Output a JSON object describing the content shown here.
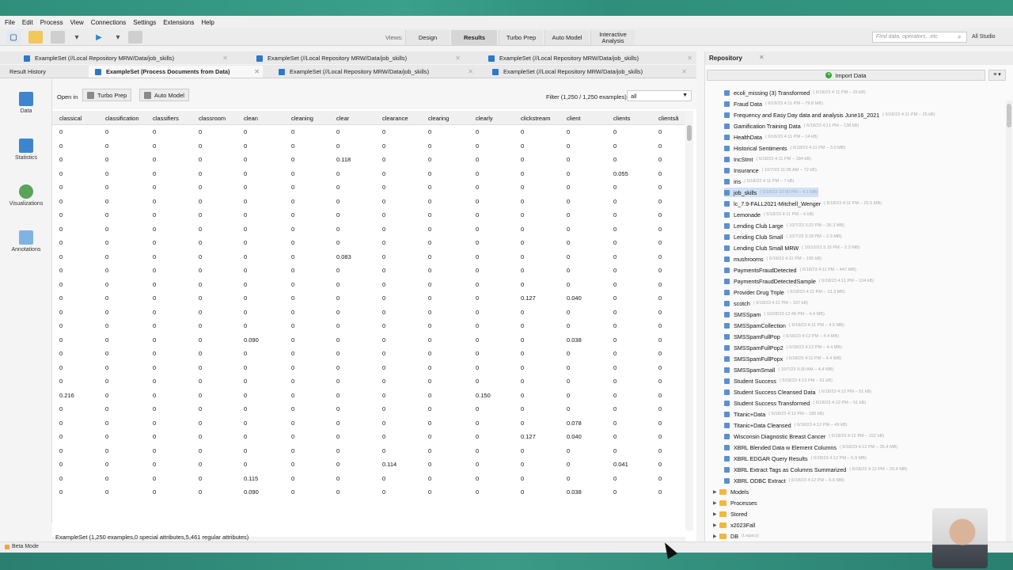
{
  "menu": [
    "File",
    "Edit",
    "Process",
    "View",
    "Connections",
    "Settings",
    "Extensions",
    "Help"
  ],
  "views": {
    "label": "Views:",
    "buttons": [
      "Design",
      "Results",
      "Turbo Prep",
      "Auto Model",
      "Interactive Analysis"
    ],
    "active": "Results"
  },
  "search": {
    "placeholder": "Find data, operators...etc",
    "studio": "All Studio"
  },
  "tabs_row1": [
    "ExampleSet (//Local Repository MRW/Data/job_skills)",
    "ExampleSet (//Local Repository MRW/Data/job_skills)",
    "ExampleSet (//Local Repository MRW/Data/job_skills)"
  ],
  "tabs_row2": [
    "Result History",
    "ExampleSet (Process Documents from Data)",
    "ExampleSet (//Local Repository MRW/Data/job_skills)",
    "ExampleSet (//Local Repository MRW/Data/job_skills)"
  ],
  "left_nav": [
    "Data",
    "Statistics",
    "Visualizations",
    "Annotations"
  ],
  "open_in": {
    "label": "Open in",
    "turbo": "Turbo Prep",
    "auto": "Auto Model"
  },
  "filter": {
    "label": "Filter (1,250 / 1,250 examples):",
    "value": "all"
  },
  "columns": [
    "classical",
    "classification",
    "classifiers",
    "classroom",
    "clean",
    "cleaning",
    "clear",
    "clearance",
    "clearing",
    "clearly",
    "clickstream",
    "client",
    "clients",
    "clientsâ"
  ],
  "rows": [
    [
      "0",
      "0",
      "0",
      "0",
      "0",
      "0",
      "0",
      "0",
      "0",
      "0",
      "0",
      "0",
      "0",
      "0"
    ],
    [
      "0",
      "0",
      "0",
      "0",
      "0",
      "0",
      "0",
      "0",
      "0",
      "0",
      "0",
      "0",
      "0",
      "0"
    ],
    [
      "0",
      "0",
      "0",
      "0",
      "0",
      "0",
      "0.118",
      "0",
      "0",
      "0",
      "0",
      "0",
      "0",
      "0"
    ],
    [
      "0",
      "0",
      "0",
      "0",
      "0",
      "0",
      "0",
      "0",
      "0",
      "0",
      "0",
      "0",
      "0.055",
      "0"
    ],
    [
      "0",
      "0",
      "0",
      "0",
      "0",
      "0",
      "0",
      "0",
      "0",
      "0",
      "0",
      "0",
      "0",
      "0"
    ],
    [
      "0",
      "0",
      "0",
      "0",
      "0",
      "0",
      "0",
      "0",
      "0",
      "0",
      "0",
      "0",
      "0",
      "0"
    ],
    [
      "0",
      "0",
      "0",
      "0",
      "0",
      "0",
      "0",
      "0",
      "0",
      "0",
      "0",
      "0",
      "0",
      "0"
    ],
    [
      "0",
      "0",
      "0",
      "0",
      "0",
      "0",
      "0",
      "0",
      "0",
      "0",
      "0",
      "0",
      "0",
      "0"
    ],
    [
      "0",
      "0",
      "0",
      "0",
      "0",
      "0",
      "0",
      "0",
      "0",
      "0",
      "0",
      "0",
      "0",
      "0"
    ],
    [
      "0",
      "0",
      "0",
      "0",
      "0",
      "0",
      "0.083",
      "0",
      "0",
      "0",
      "0",
      "0",
      "0",
      "0"
    ],
    [
      "0",
      "0",
      "0",
      "0",
      "0",
      "0",
      "0",
      "0",
      "0",
      "0",
      "0",
      "0",
      "0",
      "0"
    ],
    [
      "0",
      "0",
      "0",
      "0",
      "0",
      "0",
      "0",
      "0",
      "0",
      "0",
      "0",
      "0",
      "0",
      "0"
    ],
    [
      "0",
      "0",
      "0",
      "0",
      "0",
      "0",
      "0",
      "0",
      "0",
      "0",
      "0.127",
      "0.040",
      "0",
      "0"
    ],
    [
      "0",
      "0",
      "0",
      "0",
      "0",
      "0",
      "0",
      "0",
      "0",
      "0",
      "0",
      "0",
      "0",
      "0"
    ],
    [
      "0",
      "0",
      "0",
      "0",
      "0",
      "0",
      "0",
      "0",
      "0",
      "0",
      "0",
      "0",
      "0",
      "0"
    ],
    [
      "0",
      "0",
      "0",
      "0",
      "0.090",
      "0",
      "0",
      "0",
      "0",
      "0",
      "0",
      "0.038",
      "0",
      "0"
    ],
    [
      "0",
      "0",
      "0",
      "0",
      "0",
      "0",
      "0",
      "0",
      "0",
      "0",
      "0",
      "0",
      "0",
      "0"
    ],
    [
      "0",
      "0",
      "0",
      "0",
      "0",
      "0",
      "0",
      "0",
      "0",
      "0",
      "0",
      "0",
      "0",
      "0"
    ],
    [
      "0",
      "0",
      "0",
      "0",
      "0",
      "0",
      "0",
      "0",
      "0",
      "0",
      "0",
      "0",
      "0",
      "0"
    ],
    [
      "0.216",
      "0",
      "0",
      "0",
      "0",
      "0",
      "0",
      "0",
      "0",
      "0.150",
      "0",
      "0",
      "0",
      "0"
    ],
    [
      "0",
      "0",
      "0",
      "0",
      "0",
      "0",
      "0",
      "0",
      "0",
      "0",
      "0",
      "0",
      "0",
      "0"
    ],
    [
      "0",
      "0",
      "0",
      "0",
      "0",
      "0",
      "0",
      "0",
      "0",
      "0",
      "0",
      "0.078",
      "0",
      "0"
    ],
    [
      "0",
      "0",
      "0",
      "0",
      "0",
      "0",
      "0",
      "0",
      "0",
      "0",
      "0.127",
      "0.040",
      "0",
      "0"
    ],
    [
      "0",
      "0",
      "0",
      "0",
      "0",
      "0",
      "0",
      "0",
      "0",
      "0",
      "0",
      "0",
      "0",
      "0"
    ],
    [
      "0",
      "0",
      "0",
      "0",
      "0",
      "0",
      "0",
      "0.114",
      "0",
      "0",
      "0",
      "0",
      "0.041",
      "0"
    ],
    [
      "0",
      "0",
      "0",
      "0",
      "0.115",
      "0",
      "0",
      "0",
      "0",
      "0",
      "0",
      "0",
      "0",
      "0"
    ],
    [
      "0",
      "0",
      "0",
      "0",
      "0.090",
      "0",
      "0",
      "0",
      "0",
      "0",
      "0",
      "0.038",
      "0",
      "0"
    ]
  ],
  "status": "ExampleSet (1,250 examples,0 special attributes,5,461 regular attributes)",
  "beta": "Beta Mode",
  "repository": {
    "title": "Repository",
    "import": "Import Data",
    "items": [
      {
        "name": "ecoli_missing (3) Transformed",
        "meta": "( 6/18/23 4:11 PM – 26 kB)"
      },
      {
        "name": "Fraud Data",
        "meta": "( 6/18/23 4:11 PM – 79.8 MB)"
      },
      {
        "name": "Frequency and Easy Day data and analysis June16_2021",
        "meta": "( 6/18/23 4:11 PM – 25 kB)"
      },
      {
        "name": "Gamification Training Data",
        "meta": "( 6/18/23 4:11 PM – 138 kB)"
      },
      {
        "name": "HealthData",
        "meta": "( 6/18/23 4:11 PM – 14 kB)"
      },
      {
        "name": "Historical Sentiments",
        "meta": "( 6/18/23 4:11 PM – 3.0 MB)"
      },
      {
        "name": "IncStmt",
        "meta": "( 6/18/23 4:11 PM – 184 kB)"
      },
      {
        "name": "Insurance",
        "meta": "( 10/7/23 11:05 AM – 72 kB)"
      },
      {
        "name": "iris",
        "meta": "( 6/18/23 4:11 PM – 7 kB)"
      },
      {
        "name": "job_skills",
        "meta": "( 6/18/23 10:00 PM – 4.1 MB)"
      },
      {
        "name": "lc_7.9-FALL2021-Mitchell_Wenger",
        "meta": "( 6/18/23 4:11 PM – 25.5 MB)"
      },
      {
        "name": "Lemonade",
        "meta": "( 6/18/23 4:11 PM – 6 kB)"
      },
      {
        "name": "Lending Club Large",
        "meta": "( 10/7/23 3:22 PM – 36.3 MB)"
      },
      {
        "name": "Lending Club Small",
        "meta": "( 10/7/23 3:18 PM – 2.3 MB)"
      },
      {
        "name": "Lending Club Small MRW",
        "meta": "( 10/10/23 3:15 PM – 2.3 MB)"
      },
      {
        "name": "mushrooms",
        "meta": "( 6/18/23 4:11 PM – 195 kB)"
      },
      {
        "name": "PaymentsFraudDetected",
        "meta": "( 6/18/23 4:11 PM – 447 MB)"
      },
      {
        "name": "PaymentsFraudDetectedSample",
        "meta": "( 6/18/23 4:11 PM – 104 kB)"
      },
      {
        "name": "Provider Drug Triple",
        "meta": "( 6/18/23 4:11 PM – 13.3 MB)"
      },
      {
        "name": "scotch",
        "meta": "( 6/18/23 4:11 PM – 107 kB)"
      },
      {
        "name": "SMSSpam",
        "meta": "( 10/28/23 12:49 PM – 4.4 MB)"
      },
      {
        "name": "SMSSpamCollection",
        "meta": "( 6/18/23 4:11 PM – 4.5 MB)"
      },
      {
        "name": "SMSSpamFullPop",
        "meta": "( 6/18/23 4:12 PM – 4.4 MB)"
      },
      {
        "name": "SMSSpamFullPop2",
        "meta": "( 6/18/23 4:12 PM – 4.4 MB)"
      },
      {
        "name": "SMSSpamFullPopx",
        "meta": "( 6/18/23 4:11 PM – 4.4 MB)"
      },
      {
        "name": "SMSSpamSmall",
        "meta": "( 10/7/23 9:30 AM – 4.4 MB)"
      },
      {
        "name": "Student Success",
        "meta": "( 6/18/23 4:12 PM – 51 kB)"
      },
      {
        "name": "Student Success Cleansed Data",
        "meta": "( 6/18/23 4:12 PM – 51 kB)"
      },
      {
        "name": "Student Success Transformed",
        "meta": "( 6/18/23 4:12 PM – 51 kB)"
      },
      {
        "name": "Titanic+Data",
        "meta": "( 6/18/23 4:12 PM – 185 kB)"
      },
      {
        "name": "Titanic+Data Cleansed",
        "meta": "( 6/18/23 4:12 PM – 49 kB)"
      },
      {
        "name": "Wisconsin Diagnostic Breast Cancer",
        "meta": "( 6/18/23 4:12 PM – 152 kB)"
      },
      {
        "name": "XBRL Blended Data w Element Columns",
        "meta": "( 6/18/23 4:12 PM – 35.4 MB)"
      },
      {
        "name": "XBRL EDGAR Query Results",
        "meta": "( 6/18/23 4:12 PM – 5.9 MB)"
      },
      {
        "name": "XBRL Extract Tags as Columns Summarized",
        "meta": "( 6/18/23 4:12 PM – 20.4 MB)"
      },
      {
        "name": "XBRL ODBC Extract",
        "meta": "( 6/18/23 4:12 PM – 5.6 MB)"
      }
    ],
    "selected": "job_skills",
    "folders": [
      {
        "name": "Models",
        "meta": ""
      },
      {
        "name": "Processes",
        "meta": ""
      },
      {
        "name": "Stored",
        "meta": ""
      },
      {
        "name": "x2023Fall",
        "meta": ""
      },
      {
        "name": "DB",
        "meta": "(Legacy)"
      }
    ]
  }
}
